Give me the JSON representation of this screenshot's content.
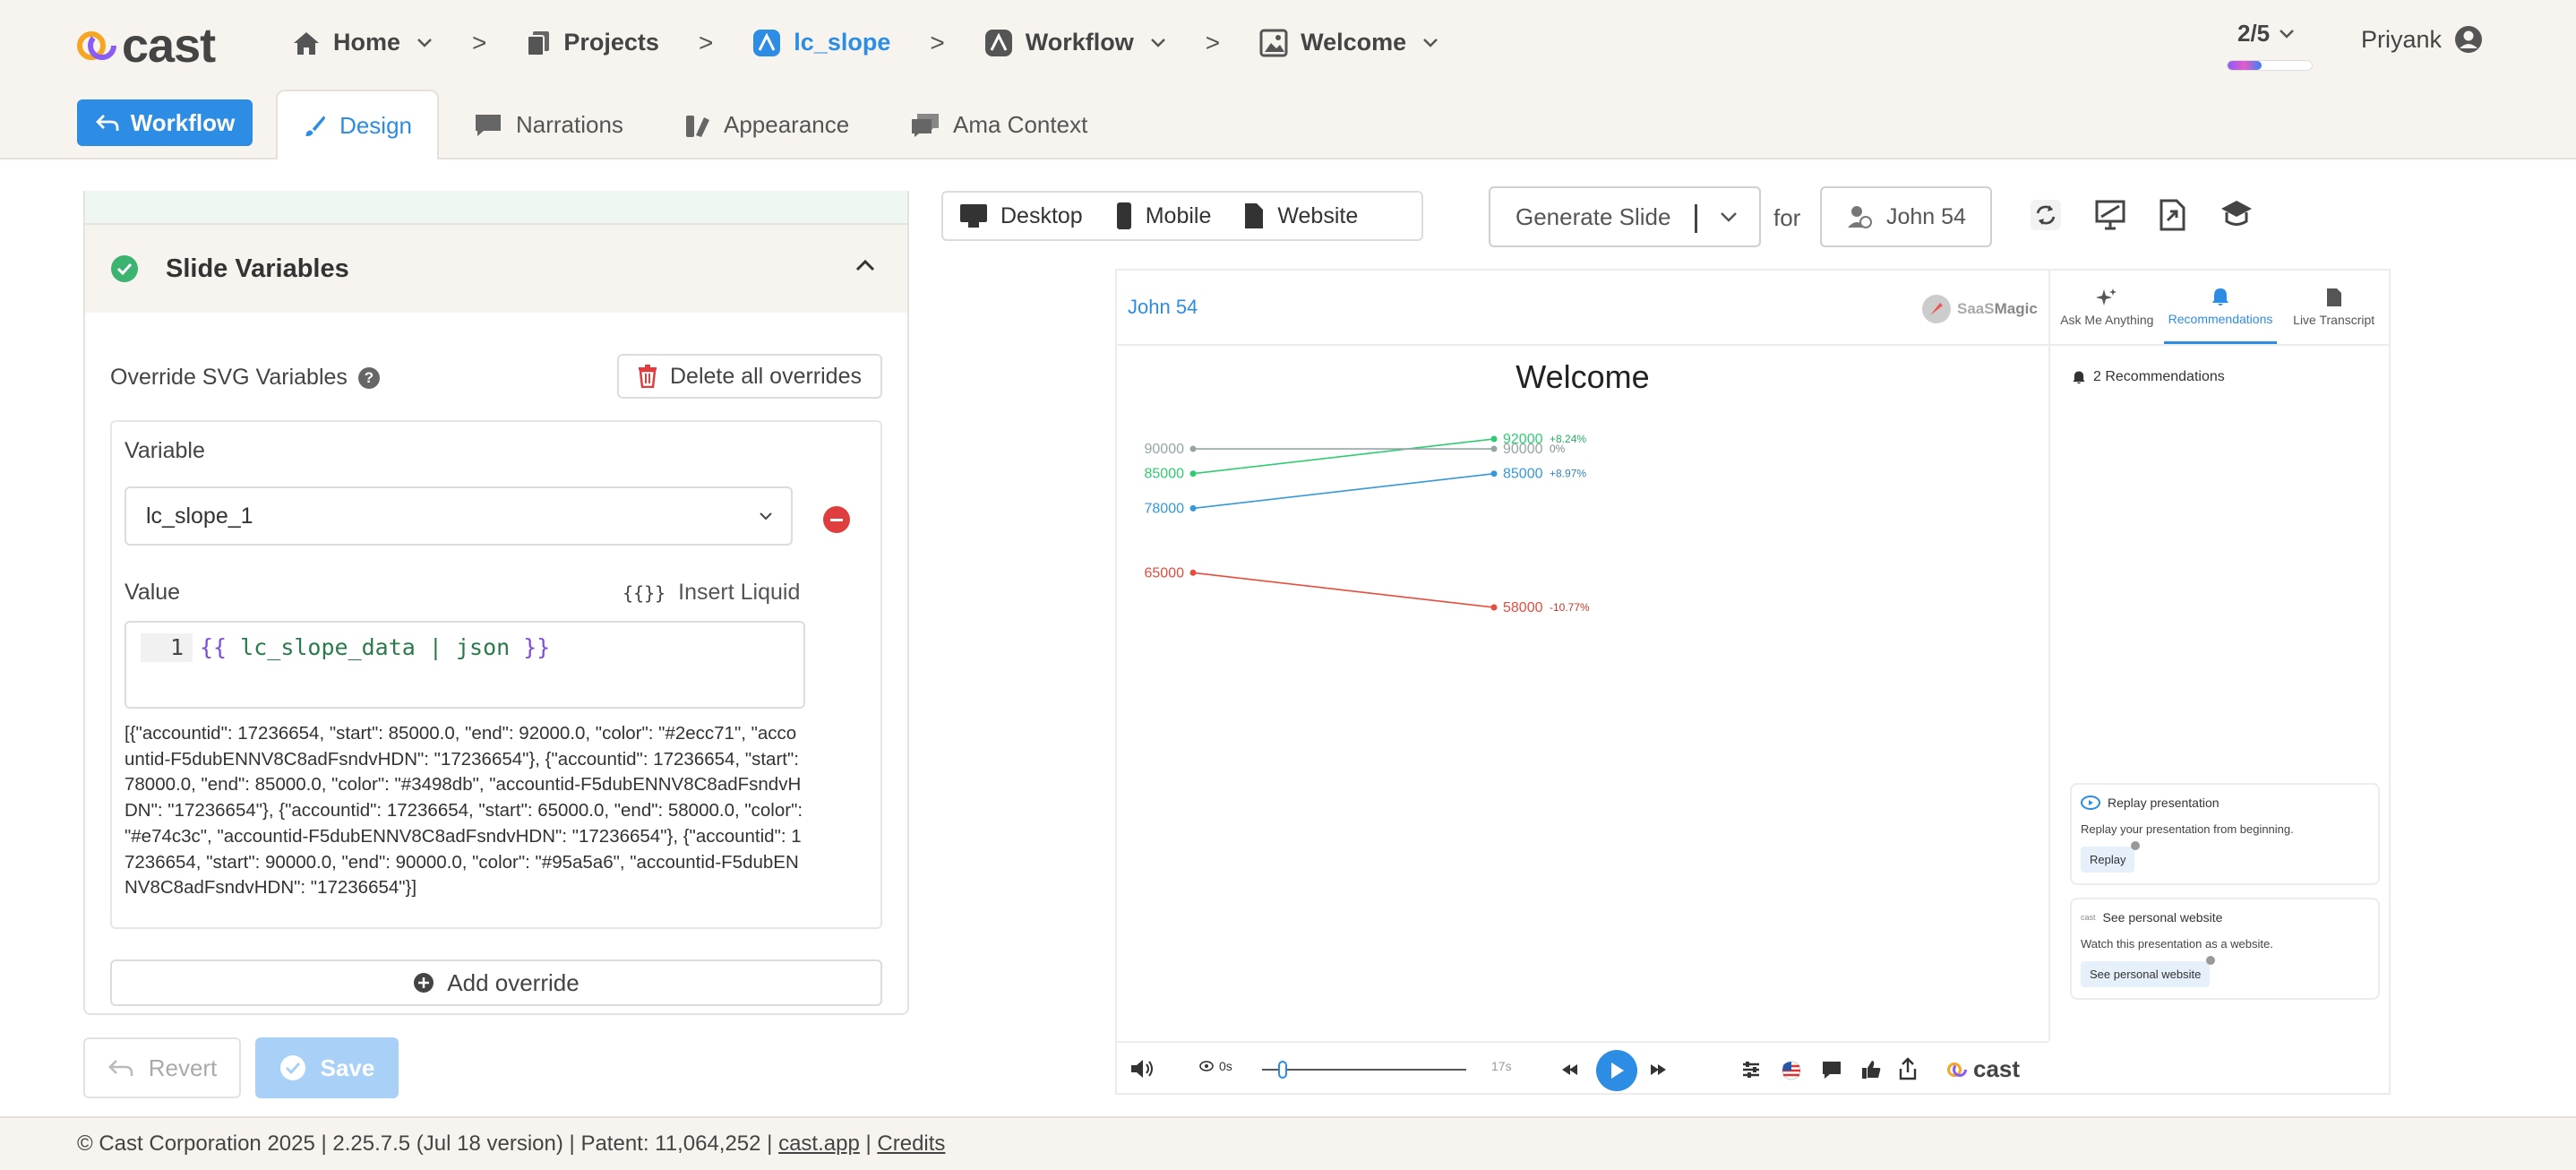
{
  "app": {
    "logo_text": "cast"
  },
  "breadcrumbs": [
    {
      "label": "Home",
      "icon": "home-icon"
    },
    {
      "label": "Projects",
      "icon": "projects-icon"
    },
    {
      "label": "lc_slope",
      "icon": "slope-icon"
    },
    {
      "label": "Workflow",
      "icon": "workflow-icon"
    },
    {
      "label": "Welcome",
      "icon": "slide-icon"
    }
  ],
  "progress": {
    "label": "2/5",
    "fraction": 0.4
  },
  "user": {
    "name": "Priyank"
  },
  "tabs": {
    "workflow_button": "Workflow",
    "items": [
      {
        "label": "Design",
        "icon": "brush-icon",
        "active": true
      },
      {
        "label": "Narrations",
        "icon": "chat-icon"
      },
      {
        "label": "Appearance",
        "icon": "appearance-icon"
      },
      {
        "label": "Ama Context",
        "icon": "context-icon"
      }
    ]
  },
  "left_panel": {
    "section_title": "Slide Variables",
    "override_label": "Override SVG Variables",
    "help": "?",
    "delete_all": "Delete all overrides",
    "variable_label": "Variable",
    "variable_value": "lc_slope_1",
    "value_label": "Value",
    "insert_liquid": "Insert Liquid",
    "liquid_icon": "{{}}",
    "line_number": "1",
    "code_open": "{{",
    "code_body": " lc_slope_data | json ",
    "code_close": "}}",
    "json_preview": "[{\"accountid\": 17236654, \"start\": 85000.0, \"end\": 92000.0, \"color\": \"#2ecc71\", \"accountid-F5dubENNV8C8adFsndvHDN\": \"17236654\"}, {\"accountid\": 17236654, \"start\": 78000.0, \"end\": 85000.0, \"color\": \"#3498db\", \"accountid-F5dubENNV8C8adFsndvHDN\": \"17236654\"}, {\"accountid\": 17236654, \"start\": 65000.0, \"end\": 58000.0, \"color\": \"#e74c3c\", \"accountid-F5dubENNV8C8adFsndvHDN\": \"17236654\"}, {\"accountid\": 17236654, \"start\": 90000.0, \"end\": 90000.0, \"color\": \"#95a5a6\", \"accountid-F5dubENNV8C8adFsndvHDN\": \"17236654\"}]",
    "add_override": "Add override",
    "revert": "Revert",
    "save": "Save"
  },
  "toolbar": {
    "devices": [
      "Desktop",
      "Mobile",
      "Website"
    ],
    "generate": "Generate Slide",
    "for": "for",
    "person": "John 54"
  },
  "preview": {
    "viewer_name": "John 54",
    "brand_a": "SaaS",
    "brand_b": "Magic",
    "slide_title": "Welcome",
    "side_tabs": [
      "Ask Me Anything",
      "Recommendations",
      "Live Transcript"
    ],
    "recs_count": "2 Recommendations",
    "card1_title": "Replay presentation",
    "card1_desc": "Replay your presentation from beginning.",
    "card1_btn": "Replay",
    "card2_logo": "cast",
    "card2_title": "See personal website",
    "card2_desc": "Watch this presentation as a website.",
    "card2_btn": "See personal website",
    "time_start": "0s",
    "time_end": "17s",
    "player_logo": "cast"
  },
  "chart_data": {
    "type": "line",
    "series": [
      {
        "start": 85000,
        "end": 92000,
        "change": "+8.24%",
        "color": "#2ecc71",
        "label_color": "#27ae60"
      },
      {
        "start": 78000,
        "end": 85000,
        "change": "+8.97%",
        "color": "#3498db",
        "label_color": "#2e86c1"
      },
      {
        "start": 65000,
        "end": 58000,
        "change": "-10.77%",
        "color": "#e74c3c",
        "label_color": "#c0392b"
      },
      {
        "start": 90000,
        "end": 90000,
        "change": "0%",
        "color": "#95a5a6",
        "label_color": "#7f8c8d"
      }
    ]
  },
  "footer": {
    "copyright": "© Cast Corporation 2025 | 2.25.7.5 (Jul 18 version) | Patent: 11,064,252 | ",
    "link1": "cast.app",
    "sep": " | ",
    "link2": "Credits"
  },
  "colors": {
    "accent": "#2d8ce3",
    "danger": "#e03e3e",
    "success": "#3cb371"
  }
}
